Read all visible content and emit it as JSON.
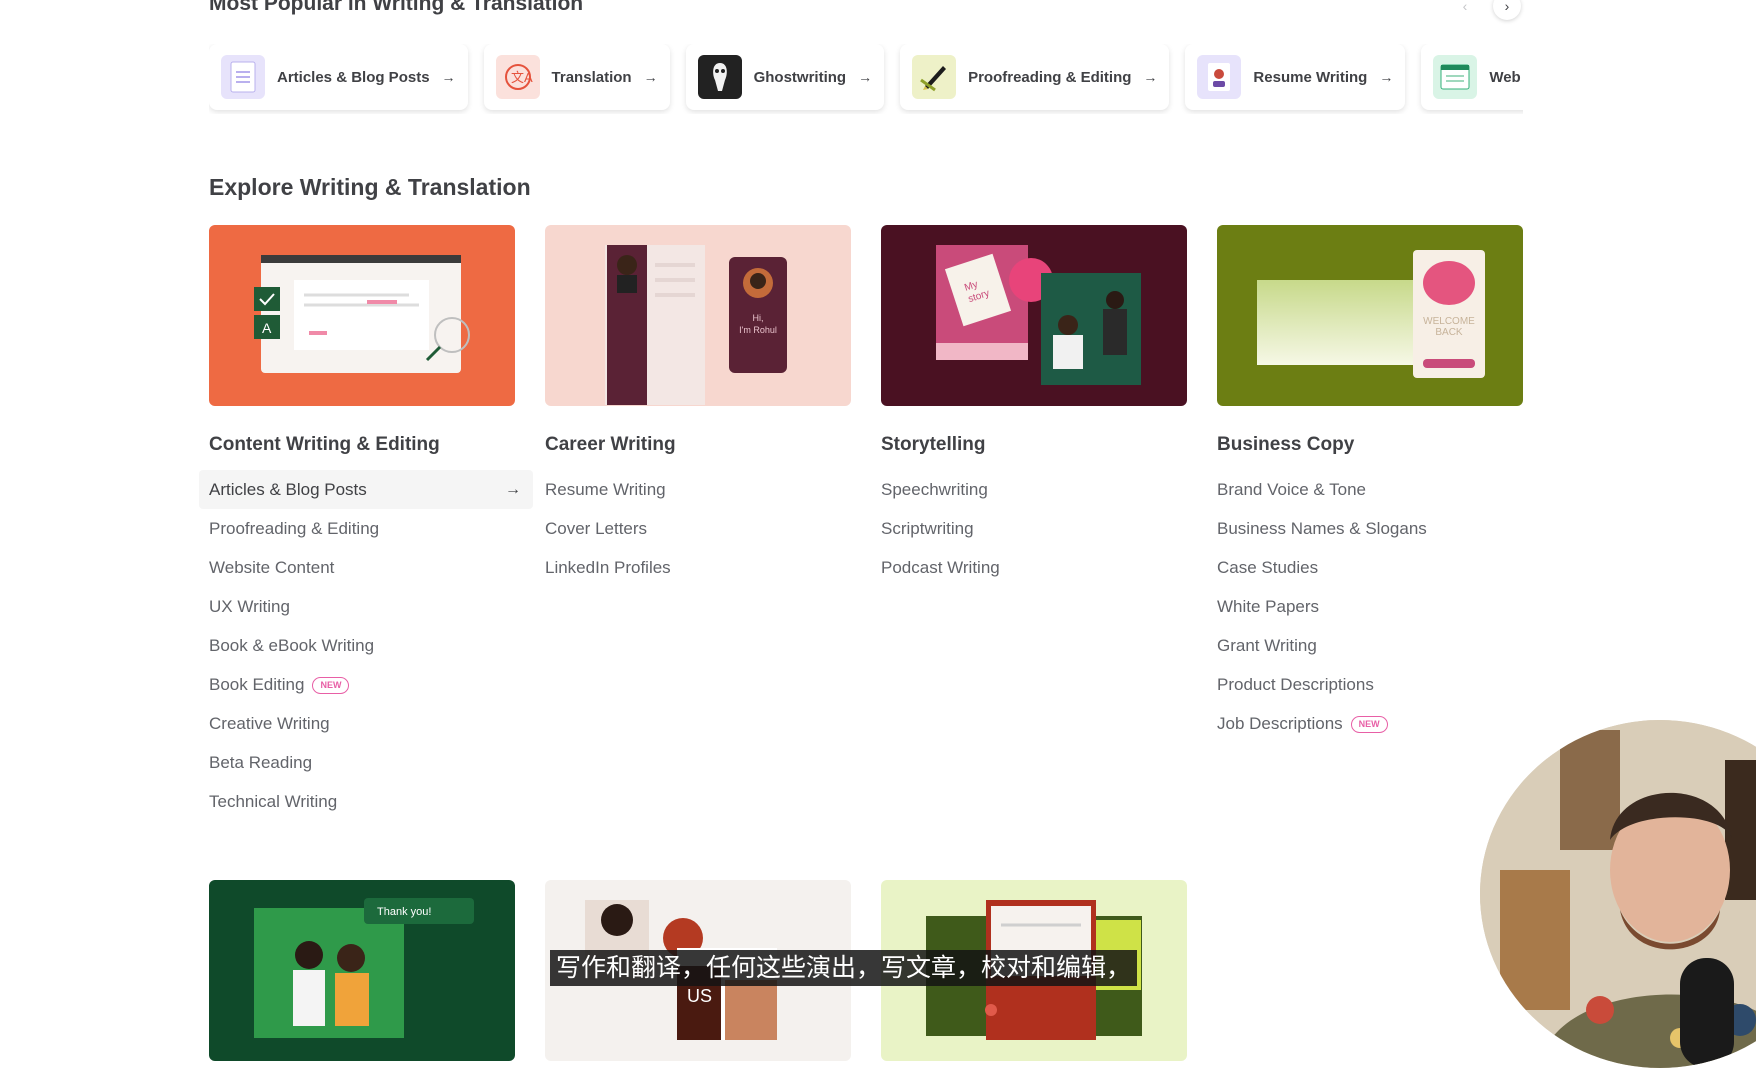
{
  "popular": {
    "title": "Most Popular in Writing & Translation",
    "items": [
      {
        "label": "Articles & Blog Posts",
        "icon": "document-icon",
        "bg": "#e7e3fb"
      },
      {
        "label": "Translation",
        "icon": "translate-icon",
        "bg": "#fbe1dc"
      },
      {
        "label": "Ghostwriting",
        "icon": "ghost-mask-icon",
        "bg": "#222222"
      },
      {
        "label": "Proofreading & Editing",
        "icon": "pen-icon",
        "bg": "#eef1c8"
      },
      {
        "label": "Resume Writing",
        "icon": "resume-icon",
        "bg": "#e7e3fb"
      },
      {
        "label": "Web",
        "icon": "web-page-icon",
        "bg": "#d9f4e6"
      }
    ]
  },
  "explore": {
    "title": "Explore Writing & Translation",
    "columns": [
      {
        "title": "Content Writing & Editing",
        "image_bg": "#ee6a43",
        "items": [
          {
            "label": "Articles & Blog Posts",
            "new": false
          },
          {
            "label": "Proofreading & Editing",
            "new": false
          },
          {
            "label": "Website Content",
            "new": false
          },
          {
            "label": "UX Writing",
            "new": false
          },
          {
            "label": "Book & eBook Writing",
            "new": false
          },
          {
            "label": "Book Editing",
            "new": true
          },
          {
            "label": "Creative Writing",
            "new": false
          },
          {
            "label": "Beta Reading",
            "new": false
          },
          {
            "label": "Technical Writing",
            "new": false
          }
        ]
      },
      {
        "title": "Career Writing",
        "image_bg": "#f7d7cf",
        "image_text": "Hi, I'm Rohul",
        "items": [
          {
            "label": "Resume Writing",
            "new": false
          },
          {
            "label": "Cover Letters",
            "new": false
          },
          {
            "label": "LinkedIn Profiles",
            "new": false
          }
        ]
      },
      {
        "title": "Storytelling",
        "image_bg": "#4a1122",
        "image_text": "My story",
        "items": [
          {
            "label": "Speechwriting",
            "new": false
          },
          {
            "label": "Scriptwriting",
            "new": false
          },
          {
            "label": "Podcast Writing",
            "new": false
          }
        ]
      },
      {
        "title": "Business Copy",
        "image_bg": "#6c7e13",
        "image_text": "WELCOME BACK",
        "items": [
          {
            "label": "Brand Voice & Tone",
            "new": false
          },
          {
            "label": "Business Names & Slogans",
            "new": false
          },
          {
            "label": "Case Studies",
            "new": false
          },
          {
            "label": "White Papers",
            "new": false
          },
          {
            "label": "Grant Writing",
            "new": false
          },
          {
            "label": "Product Descriptions",
            "new": false
          },
          {
            "label": "Job Descriptions",
            "new": true
          }
        ]
      }
    ],
    "new_badge": "NEW",
    "bottom_images": [
      {
        "bg": "#0f4a2a",
        "text": "Thank you!"
      },
      {
        "bg": "#f4f1ee",
        "text": "US"
      },
      {
        "bg": "#e9f3c6",
        "text": ""
      }
    ]
  },
  "pager": {
    "prev": "‹",
    "next": "›"
  },
  "subtitle": "写作和翻译，任何这些演出，写文章，校对和编辑，",
  "colors": {
    "heading": "#404145",
    "link": "#62646a",
    "new_badge": "#e85fa6"
  }
}
